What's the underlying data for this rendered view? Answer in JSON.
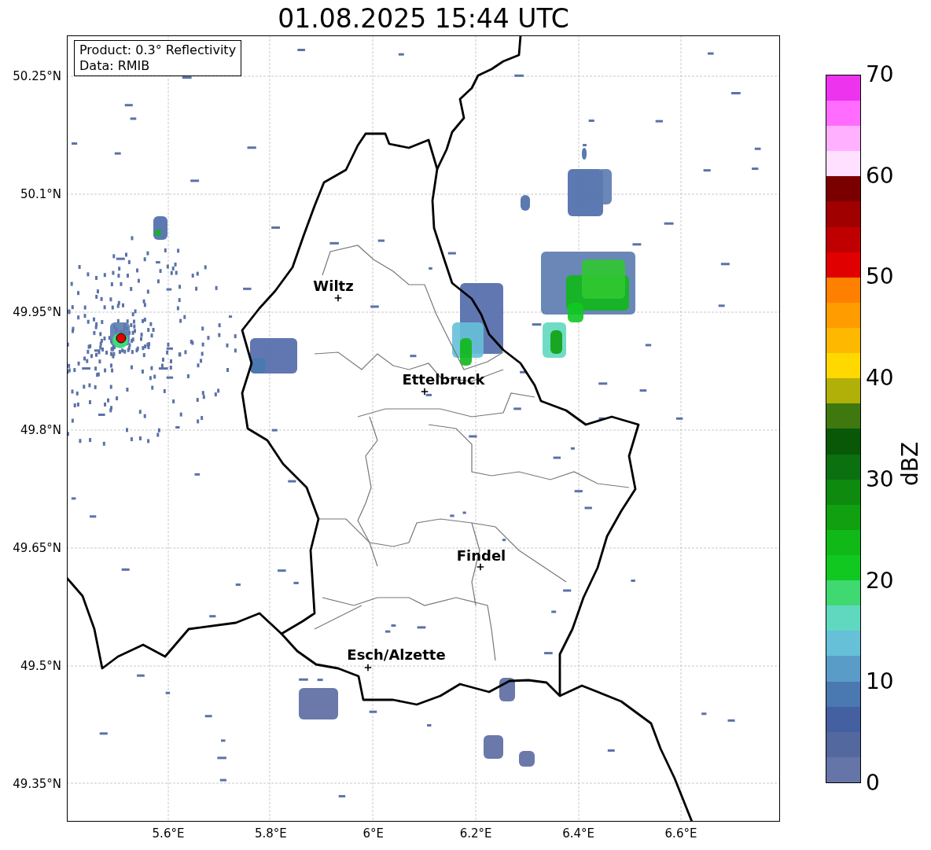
{
  "title": "01.08.2025 15:44 UTC",
  "map": {
    "info_box": [
      "Product: 0.3° Reflectivity",
      "Data: RMIB"
    ],
    "lat_ticks": [
      "50.25°N",
      "50.1°N",
      "49.95°N",
      "49.8°N",
      "49.65°N",
      "49.5°N",
      "49.35°N"
    ],
    "lon_ticks": [
      "5.6°E",
      "5.8°E",
      "6°E",
      "6.2°E",
      "6.4°E",
      "6.6°E"
    ],
    "cities": [
      {
        "name": "Wiltz"
      },
      {
        "name": "Ettelbruck"
      },
      {
        "name": "Findel"
      },
      {
        "name": "Esch/Alzette"
      }
    ]
  },
  "colorbar": {
    "label": "dBZ",
    "ticks": [
      "70",
      "60",
      "50",
      "40",
      "30",
      "20",
      "10",
      "0"
    ]
  }
}
